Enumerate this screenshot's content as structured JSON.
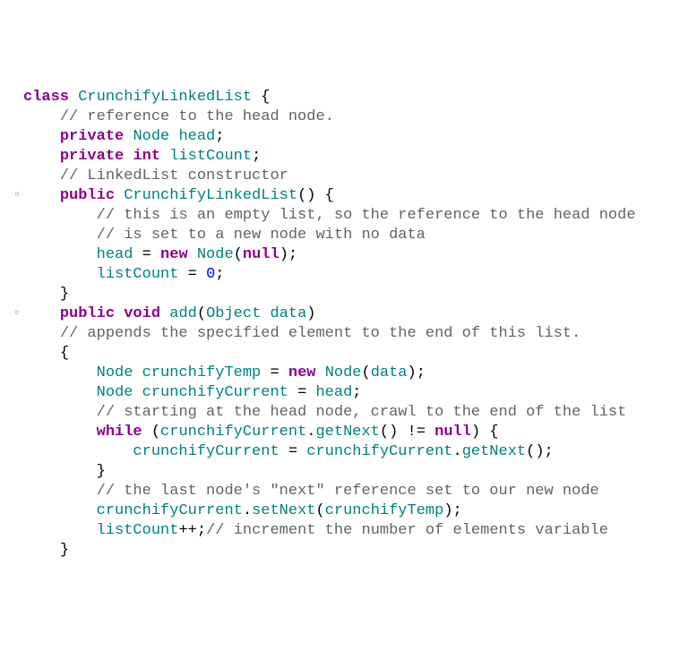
{
  "code": {
    "lines": [
      {
        "indent": 0,
        "mark": false,
        "tokens": [
          [
            "kw",
            "class"
          ],
          [
            "black",
            " "
          ],
          [
            "id",
            "CrunchifyLinkedList"
          ],
          [
            "black",
            " {"
          ]
        ]
      },
      {
        "indent": 1,
        "mark": false,
        "tokens": [
          [
            "cmt",
            "// reference to the head node."
          ]
        ]
      },
      {
        "indent": 1,
        "mark": false,
        "tokens": [
          [
            "kw",
            "private"
          ],
          [
            "black",
            " "
          ],
          [
            "id",
            "Node"
          ],
          [
            "black",
            " "
          ],
          [
            "id",
            "head"
          ],
          [
            "black",
            ";"
          ]
        ]
      },
      {
        "indent": 1,
        "mark": false,
        "tokens": [
          [
            "kw",
            "private"
          ],
          [
            "black",
            " "
          ],
          [
            "kw",
            "int"
          ],
          [
            "black",
            " "
          ],
          [
            "id",
            "listCount"
          ],
          [
            "black",
            ";"
          ]
        ]
      },
      {
        "indent": 0,
        "mark": false,
        "tokens": [
          [
            "black",
            ""
          ]
        ]
      },
      {
        "indent": 1,
        "mark": false,
        "tokens": [
          [
            "cmt",
            "// LinkedList constructor"
          ]
        ]
      },
      {
        "indent": 1,
        "mark": true,
        "tokens": [
          [
            "kw",
            "public"
          ],
          [
            "black",
            " "
          ],
          [
            "id",
            "CrunchifyLinkedList"
          ],
          [
            "black",
            "() {"
          ]
        ]
      },
      {
        "indent": 2,
        "mark": false,
        "tokens": [
          [
            "cmt",
            "// this is an empty list, so the reference to the head node"
          ]
        ]
      },
      {
        "indent": 2,
        "mark": false,
        "tokens": [
          [
            "cmt",
            "// is set to a new node with no data"
          ]
        ]
      },
      {
        "indent": 2,
        "mark": false,
        "tokens": [
          [
            "id",
            "head"
          ],
          [
            "black",
            " = "
          ],
          [
            "kw",
            "new"
          ],
          [
            "black",
            " "
          ],
          [
            "id",
            "Node"
          ],
          [
            "black",
            "("
          ],
          [
            "null",
            "null"
          ],
          [
            "black",
            ");"
          ]
        ]
      },
      {
        "indent": 2,
        "mark": false,
        "tokens": [
          [
            "id",
            "listCount"
          ],
          [
            "black",
            " = "
          ],
          [
            "num",
            "0"
          ],
          [
            "black",
            ";"
          ]
        ]
      },
      {
        "indent": 1,
        "mark": false,
        "tokens": [
          [
            "black",
            "}"
          ]
        ]
      },
      {
        "indent": 0,
        "mark": false,
        "tokens": [
          [
            "black",
            ""
          ]
        ]
      },
      {
        "indent": 1,
        "mark": true,
        "tokens": [
          [
            "kw",
            "public"
          ],
          [
            "black",
            " "
          ],
          [
            "kw",
            "void"
          ],
          [
            "black",
            " "
          ],
          [
            "id",
            "add"
          ],
          [
            "black",
            "("
          ],
          [
            "id",
            "Object"
          ],
          [
            "black",
            " "
          ],
          [
            "id",
            "data"
          ],
          [
            "black",
            ")"
          ]
        ]
      },
      {
        "indent": 1,
        "mark": false,
        "tokens": [
          [
            "cmt",
            "// appends the specified element to the end of this list."
          ]
        ]
      },
      {
        "indent": 1,
        "mark": false,
        "tokens": [
          [
            "black",
            "{"
          ]
        ]
      },
      {
        "indent": 2,
        "mark": false,
        "tokens": [
          [
            "id",
            "Node"
          ],
          [
            "black",
            " "
          ],
          [
            "id",
            "crunchifyTemp"
          ],
          [
            "black",
            " = "
          ],
          [
            "kw",
            "new"
          ],
          [
            "black",
            " "
          ],
          [
            "id",
            "Node"
          ],
          [
            "black",
            "("
          ],
          [
            "id",
            "data"
          ],
          [
            "black",
            ");"
          ]
        ]
      },
      {
        "indent": 2,
        "mark": false,
        "tokens": [
          [
            "id",
            "Node"
          ],
          [
            "black",
            " "
          ],
          [
            "id",
            "crunchifyCurrent"
          ],
          [
            "black",
            " = "
          ],
          [
            "id",
            "head"
          ],
          [
            "black",
            ";"
          ]
        ]
      },
      {
        "indent": 2,
        "mark": false,
        "tokens": [
          [
            "cmt",
            "// starting at the head node, crawl to the end of the list"
          ]
        ]
      },
      {
        "indent": 2,
        "mark": false,
        "tokens": [
          [
            "kw",
            "while"
          ],
          [
            "black",
            " ("
          ],
          [
            "id",
            "crunchifyCurrent"
          ],
          [
            "black",
            "."
          ],
          [
            "id",
            "getNext"
          ],
          [
            "black",
            "() != "
          ],
          [
            "null",
            "null"
          ],
          [
            "black",
            ") {"
          ]
        ]
      },
      {
        "indent": 3,
        "mark": false,
        "tokens": [
          [
            "id",
            "crunchifyCurrent"
          ],
          [
            "black",
            " = "
          ],
          [
            "id",
            "crunchifyCurrent"
          ],
          [
            "black",
            "."
          ],
          [
            "id",
            "getNext"
          ],
          [
            "black",
            "();"
          ]
        ]
      },
      {
        "indent": 2,
        "mark": false,
        "tokens": [
          [
            "black",
            "}"
          ]
        ]
      },
      {
        "indent": 2,
        "mark": false,
        "tokens": [
          [
            "cmt",
            "// the last node's \"next\" reference set to our new node"
          ]
        ]
      },
      {
        "indent": 2,
        "mark": false,
        "tokens": [
          [
            "id",
            "crunchifyCurrent"
          ],
          [
            "black",
            "."
          ],
          [
            "id",
            "setNext"
          ],
          [
            "black",
            "("
          ],
          [
            "id",
            "crunchifyTemp"
          ],
          [
            "black",
            ");"
          ]
        ]
      },
      {
        "indent": 2,
        "mark": false,
        "tokens": [
          [
            "id",
            "listCount"
          ],
          [
            "black",
            "++;"
          ],
          [
            "cmt",
            "// increment the number of elements variable"
          ]
        ]
      },
      {
        "indent": 1,
        "mark": false,
        "tokens": [
          [
            "black",
            "}"
          ]
        ]
      }
    ],
    "indentUnit": "    "
  }
}
